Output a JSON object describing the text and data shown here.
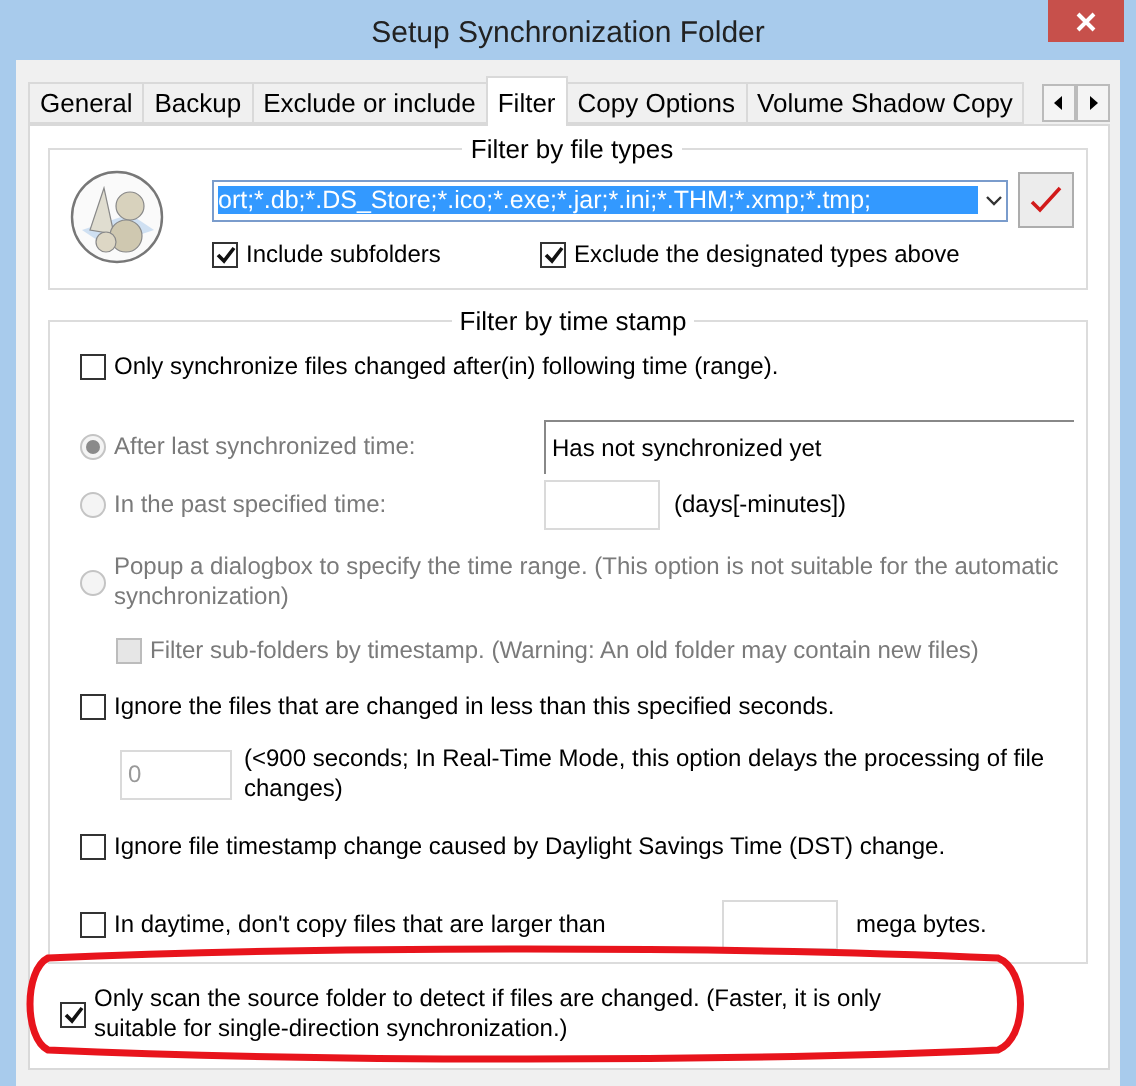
{
  "window": {
    "title": "Setup Synchronization Folder"
  },
  "tabs": [
    {
      "label": "General",
      "selected": false
    },
    {
      "label": "Backup",
      "selected": false
    },
    {
      "label": "Exclude or include",
      "selected": false
    },
    {
      "label": "Filter",
      "selected": true
    },
    {
      "label": "Copy Options",
      "selected": false
    },
    {
      "label": "Volume Shadow Copy",
      "selected": false
    }
  ],
  "file_types": {
    "title": "Filter by file types",
    "value": "ort;*.db;*.DS_Store;*.ico;*.exe;*.jar;*.ini;*.THM;*.xmp;*.tmp;",
    "value_selected": true,
    "options": [
      {
        "label": "Include subfolders",
        "checked": true
      },
      {
        "label": "Exclude the designated types above",
        "checked": true
      }
    ]
  },
  "time_stamp": {
    "title": "Filter by time stamp",
    "items": [
      {
        "kind": "checkbox",
        "label": "Only synchronize files changed after(in) following time (range).",
        "checked": false,
        "disabled": false
      },
      {
        "kind": "radio-value",
        "label": "After last synchronized time:",
        "selected": true,
        "disabled": true,
        "value": "Has not synchronized yet"
      },
      {
        "kind": "radio-field",
        "label": "In the past specified time:",
        "selected": false,
        "disabled": true,
        "suffix": "(days[-minutes])"
      },
      {
        "kind": "radio",
        "label": "Popup a dialogbox to specify the time range. (This option is not suitable for the automatic synchronization)",
        "selected": false,
        "disabled": true
      },
      {
        "kind": "sub-checkbox",
        "label": "Filter sub-folders by timestamp. (Warning: An old folder may contain new files)",
        "checked": false,
        "disabled": true
      },
      {
        "kind": "checkbox",
        "label": "Ignore the files that are changed in less than this specified seconds.",
        "checked": false,
        "disabled": false
      },
      {
        "kind": "seconds",
        "value": "0",
        "disabled": true,
        "note": "(<900 seconds; In Real-Time Mode, this option delays the processing of file changes)"
      },
      {
        "kind": "checkbox",
        "label": "Ignore file timestamp change caused by Daylight Savings Time (DST) change.",
        "checked": false,
        "disabled": false
      },
      {
        "kind": "checkbox-field",
        "label": "In daytime, don't copy files that are larger than",
        "checked": false,
        "disabled": false,
        "suffix": "mega bytes."
      }
    ]
  },
  "scan_option": {
    "label": "Only scan the source folder to detect if files are changed. (Faster, it is only suitable for single-direction synchronization.)",
    "checked": true,
    "highlighted": true
  }
}
